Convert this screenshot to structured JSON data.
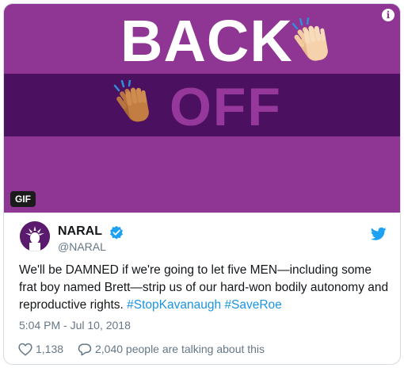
{
  "media": {
    "headline_top": "BACK",
    "headline_bottom": "OFF",
    "badge": "GIF",
    "info_symbol": "i",
    "icons": [
      "clapping-hands-light-icon",
      "clapping-hands-dark-icon",
      "info-icon"
    ],
    "colors": {
      "background": "#8f3593",
      "band": "#4b105f",
      "off_text": "#96379b"
    }
  },
  "tweet": {
    "author_name": "NARAL",
    "author_handle": "@NARAL",
    "text_before": "We'll be DAMNED if we're going to let five MEN—including some frat boy named Brett—strip us of our hard-won bodily autonomy and reproductive rights. ",
    "hashtag_1": "#StopKavanaugh",
    "hashtag_2": "#SaveRoe",
    "timestamp": "5:04 PM - Jul 10, 2018",
    "likes": "1,138",
    "talking": "2,040 people are talking about this",
    "icons": [
      "avatar",
      "verified-badge-icon",
      "twitter-bird-icon",
      "heart-icon",
      "reply-bubble-icon"
    ],
    "colors": {
      "link": "#1b95e0",
      "muted": "#657786",
      "text": "#14171a"
    }
  }
}
